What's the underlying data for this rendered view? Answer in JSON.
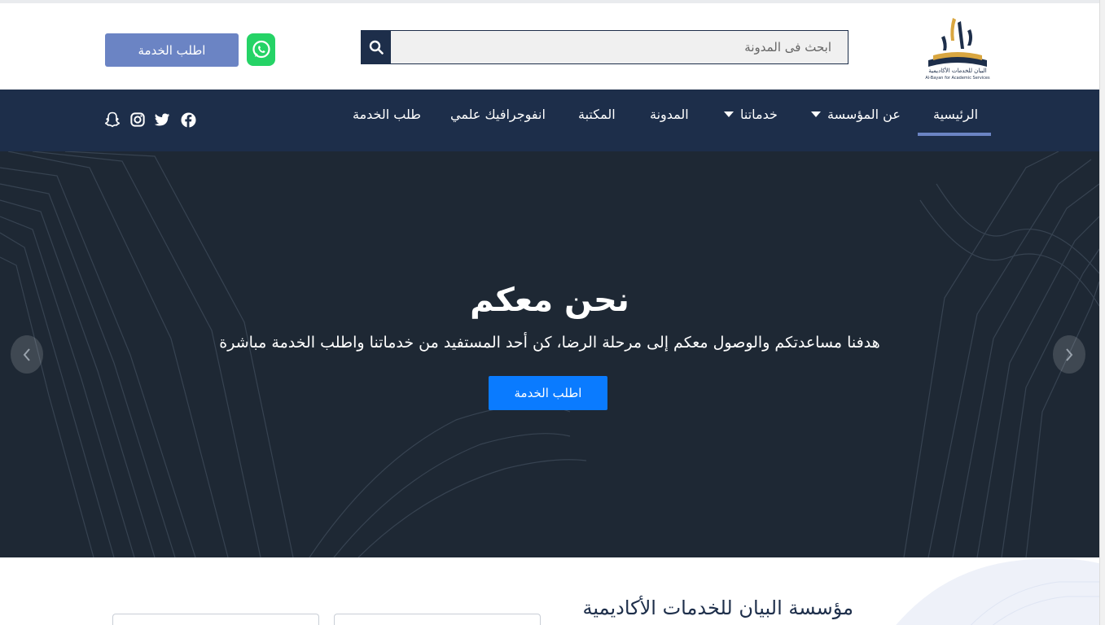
{
  "header": {
    "logo_caption_ar": "البيان للخدمات الأكاديمية",
    "logo_caption_en": "Al-Bayan for Academic Services",
    "search_placeholder": "ابحث فى المدونة",
    "order_button": "اطلب الخدمة"
  },
  "nav": {
    "items": [
      {
        "label": "الرئيسية",
        "active": true
      },
      {
        "label": "عن المؤسسة",
        "has_dropdown": true
      },
      {
        "label": "خدماتنا",
        "has_dropdown": true
      },
      {
        "label": "المدونة"
      },
      {
        "label": "المكتبة"
      },
      {
        "label": "انفوجرافيك علمي"
      },
      {
        "label": "طلب الخدمة"
      }
    ],
    "social": [
      "facebook-icon",
      "twitter-icon",
      "instagram-icon",
      "snapchat-icon"
    ]
  },
  "hero": {
    "title": "نحن معكم",
    "subtitle": "هدفنا مساعدتكم والوصول معكم إلى مرحلة الرضا، كن أحد المستفيد من خدماتنا واطلب الخدمة مباشرة",
    "button": "اطلب الخدمة"
  },
  "about": {
    "title": "مؤسسة البيان للخدمات الأكاديمية"
  },
  "colors": {
    "navy": "#1d2e4a",
    "accent": "#6b84c4",
    "hero_bg": "#1e2834",
    "cta_blue": "#0a7bff",
    "whatsapp": "#25d366"
  }
}
